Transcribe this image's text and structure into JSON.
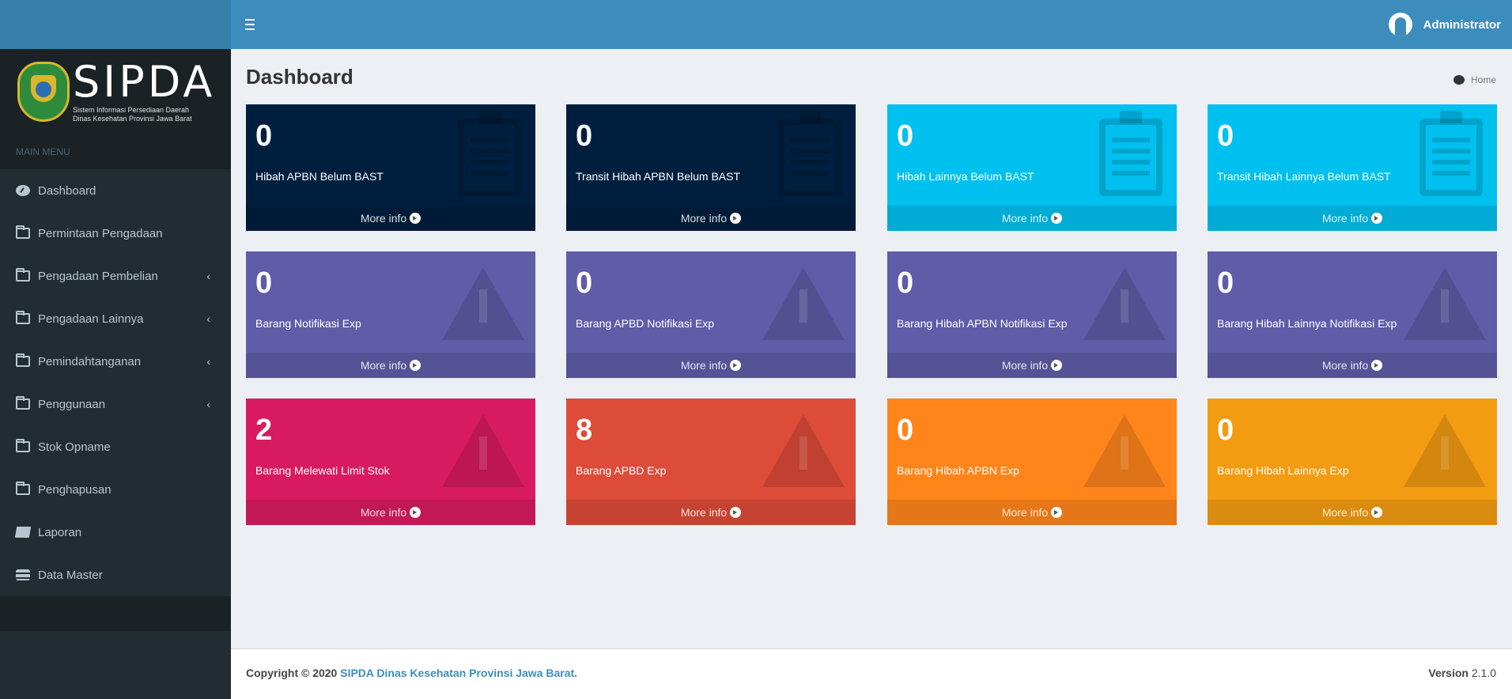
{
  "header": {
    "user_name": "Administrator"
  },
  "logo": {
    "title": "SIPDA",
    "subtitle_line1": "Sistem Informasi Persediaan Daerah",
    "subtitle_line2": "Dinas Kesehatan Provinsi Jawa Barat"
  },
  "sidebar": {
    "header": "MAIN MENU",
    "items": [
      {
        "label": "Dashboard",
        "icon": "dashboard-icon",
        "submenu": false
      },
      {
        "label": "Permintaan Pengadaan",
        "icon": "folder-open-icon",
        "submenu": false
      },
      {
        "label": "Pengadaan Pembelian",
        "icon": "folder-open-icon",
        "submenu": true
      },
      {
        "label": "Pengadaan Lainnya",
        "icon": "folder-open-icon",
        "submenu": true
      },
      {
        "label": "Pemindahtanganan",
        "icon": "folder-open-icon",
        "submenu": true
      },
      {
        "label": "Penggunaan",
        "icon": "folder-open-icon",
        "submenu": true
      },
      {
        "label": "Stok Opname",
        "icon": "folder-open-icon",
        "submenu": false
      },
      {
        "label": "Penghapusan",
        "icon": "folder-open-icon",
        "submenu": false
      },
      {
        "label": "Laporan",
        "icon": "book-icon",
        "submenu": false
      },
      {
        "label": "Data Master",
        "icon": "database-icon",
        "submenu": false
      }
    ],
    "chevron": "‹"
  },
  "page": {
    "title": "Dashboard",
    "breadcrumb": "Home"
  },
  "boxes": [
    {
      "value": "0",
      "label": "Hibah APBN Belum BAST",
      "color": "#001f3f",
      "icon": "clipboard-icon",
      "footer": "More info"
    },
    {
      "value": "0",
      "label": "Transit Hibah APBN Belum BAST",
      "color": "#001f3f",
      "icon": "clipboard-icon",
      "footer": "More info"
    },
    {
      "value": "0",
      "label": "Hibah Lainnya Belum BAST",
      "color": "#00c0ef",
      "icon": "clipboard-icon",
      "footer": "More info"
    },
    {
      "value": "0",
      "label": "Transit Hibah Lainnya Belum BAST",
      "color": "#00c0ef",
      "icon": "clipboard-icon",
      "footer": "More info"
    },
    {
      "value": "0",
      "label": "Barang Notifikasi Exp",
      "color": "#605ca8",
      "icon": "warning-icon",
      "footer": "More info"
    },
    {
      "value": "0",
      "label": "Barang APBD Notifikasi Exp",
      "color": "#605ca8",
      "icon": "warning-icon",
      "footer": "More info"
    },
    {
      "value": "0",
      "label": "Barang Hibah APBN Notifikasi Exp",
      "color": "#605ca8",
      "icon": "warning-icon",
      "footer": "More info"
    },
    {
      "value": "0",
      "label": "Barang Hibah Lainnya Notifikasi Exp",
      "color": "#605ca8",
      "icon": "warning-icon",
      "footer": "More info"
    },
    {
      "value": "2",
      "label": "Barang Melewati Limit Stok",
      "color": "#d81b60",
      "icon": "warning-icon",
      "footer": "More info"
    },
    {
      "value": "8",
      "label": "Barang APBD Exp",
      "color": "#dd4b39",
      "icon": "warning-icon",
      "footer": "More info"
    },
    {
      "value": "0",
      "label": "Barang Hibah APBN Exp",
      "color": "#ff851b",
      "icon": "warning-icon",
      "footer": "More info"
    },
    {
      "value": "0",
      "label": "Barang Hibah Lainnya Exp",
      "color": "#f39c12",
      "icon": "warning-icon",
      "footer": "More info"
    }
  ],
  "footer": {
    "copyright_prefix": "Copyright © 2020",
    "copyright_link": "SIPDA Dinas Kesehatan Provinsi Jawa Barat.",
    "version_label": "Version",
    "version_value": "2.1.0"
  }
}
